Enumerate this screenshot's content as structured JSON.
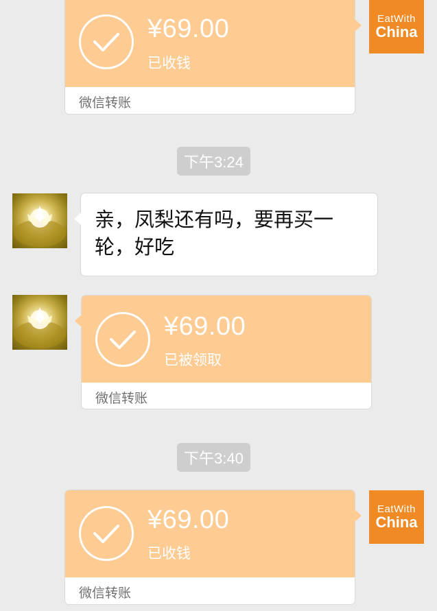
{
  "timestamps": [
    "下午3:24",
    "下午3:40"
  ],
  "brand_avatar": {
    "line1": "EatWith",
    "line2": "China",
    "color": "#f08a24"
  },
  "transfers": [
    {
      "amount": "¥69.00",
      "status": "已收钱",
      "label": "微信转账",
      "side": "right"
    },
    {
      "amount": "¥69.00",
      "status": "已被领取",
      "label": "微信转账",
      "side": "left"
    },
    {
      "amount": "¥69.00",
      "status": "已收钱",
      "label": "微信转账",
      "side": "right"
    }
  ],
  "text_message": {
    "side": "left",
    "text": "亲，凤梨还有吗，要再买一轮，好吃"
  },
  "colors": {
    "transfer_orange": "#fecb92",
    "background": "#ebebeb",
    "timestamp_bg": "#cecece"
  }
}
